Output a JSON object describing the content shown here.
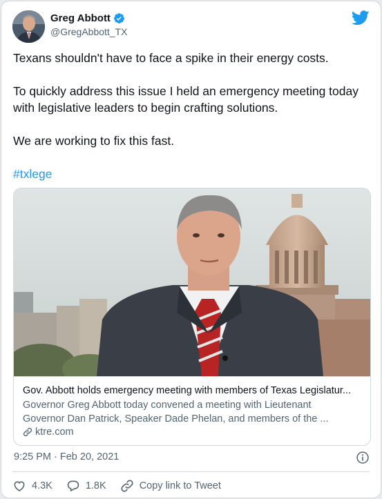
{
  "tweet": {
    "author": {
      "display_name": "Greg Abbott",
      "handle": "@GregAbbott_TX",
      "verified": true
    },
    "paragraphs": [
      "Texans shouldn't have to face a spike in their energy costs.",
      "To quickly address this issue I held an emergency meeting today with legislative leaders to begin crafting solutions.",
      "We are working to fix this fast."
    ],
    "hashtag": "#txlege",
    "link_card": {
      "title": "Gov. Abbott holds emergency meeting with members of Texas Legislatur...",
      "description_line1": "Governor Greg Abbott today convened a meeting with Lieutenant",
      "description_line2": "Governor Dan Patrick, Speaker Dade Phelan, and members of the ...",
      "domain": "ktre.com"
    },
    "timestamp": "9:25 PM · Feb 20, 2021",
    "actions": {
      "likes": "4.3K",
      "replies": "1.8K",
      "copy_link": "Copy link to Tweet"
    }
  },
  "colors": {
    "accent": "#1d9bf0",
    "text": "#0f1419",
    "muted": "#536471",
    "border": "#cfd9de"
  },
  "icons": [
    "twitter-logo-icon",
    "verified-badge-icon",
    "link-icon",
    "info-icon",
    "heart-icon",
    "reply-icon",
    "copy-link-icon"
  ]
}
